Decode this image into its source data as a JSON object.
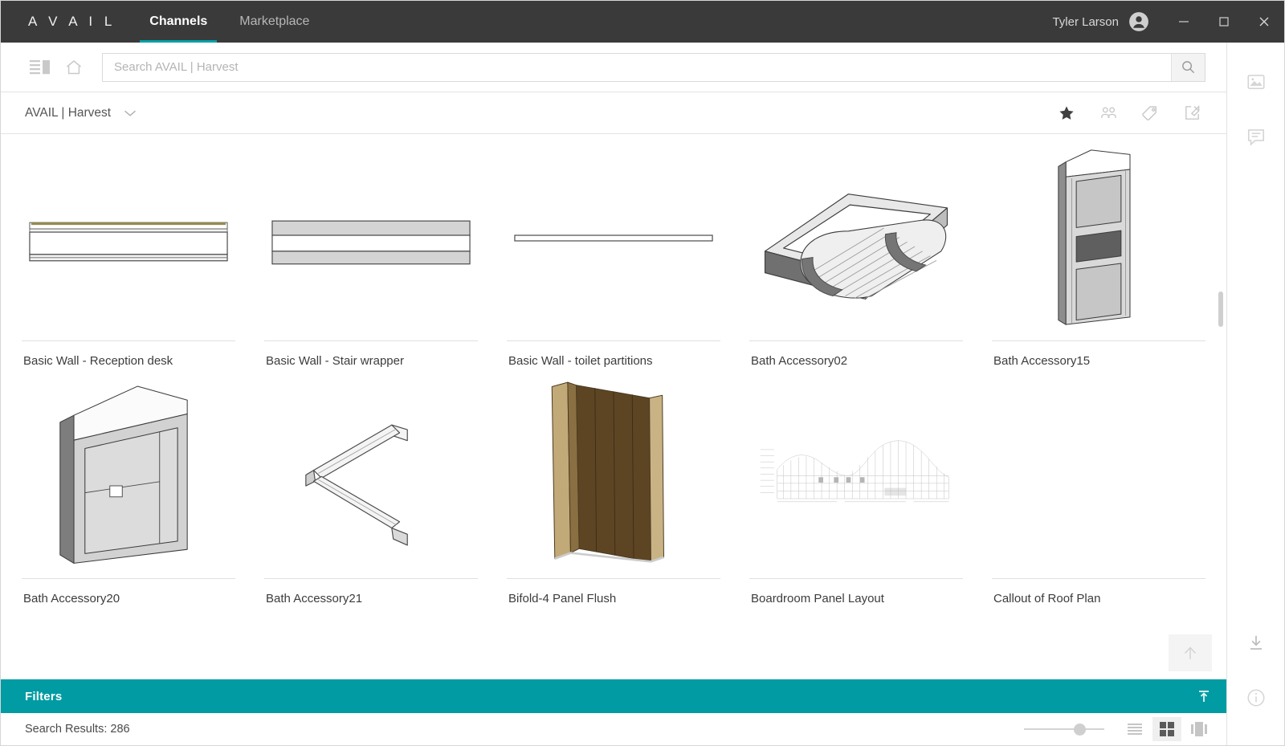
{
  "titlebar": {
    "brand": "A V A I L",
    "tabs": [
      {
        "label": "Channels",
        "active": true
      },
      {
        "label": "Marketplace",
        "active": false
      }
    ],
    "user": "Tyler Larson",
    "window_controls": [
      "minimize",
      "maximize",
      "close"
    ],
    "bg_color": "#3a3a3a",
    "accent_color": "#00a0a8"
  },
  "toolbar": {
    "panel_toggle": "panel-toggle-icon",
    "home": "home-icon",
    "search_placeholder": "Search AVAIL | Harvest",
    "search_value": "",
    "search_button": "search-icon"
  },
  "channel": {
    "name": "AVAIL | Harvest",
    "dropdown": "chevron-down-icon",
    "actions": [
      {
        "name": "favorite-star-icon",
        "active": true
      },
      {
        "name": "users-icon",
        "active": false
      },
      {
        "name": "tag-icon",
        "active": false
      },
      {
        "name": "edit-icon",
        "active": false
      }
    ]
  },
  "grid": {
    "rows": [
      {
        "items": [
          {
            "label": "Basic Wall - Reception desk",
            "thumb": "wall-section-reception"
          },
          {
            "label": "Basic Wall - Stair wrapper",
            "thumb": "wall-section-stair"
          },
          {
            "label": "Basic Wall - toilet partitions",
            "thumb": "wall-section-thin"
          },
          {
            "label": "Bath Accessory02",
            "thumb": "bath-accessory-tray-3d"
          },
          {
            "label": "Bath Accessory15",
            "thumb": "bath-accessory-panel-3d"
          }
        ]
      },
      {
        "items": [
          {
            "label": "Bath Accessory20",
            "thumb": "bath-cabinet-3d"
          },
          {
            "label": "Bath Accessory21",
            "thumb": "grab-bar-3d"
          },
          {
            "label": "Bifold-4 Panel Flush",
            "thumb": "bifold-door-3d"
          },
          {
            "label": "Boardroom Panel Layout",
            "thumb": "elevation-drawing"
          },
          {
            "label": "Callout of Roof Plan",
            "thumb": "empty"
          }
        ]
      }
    ],
    "scroll_to_top": "arrow-up-icon"
  },
  "filters": {
    "label": "Filters",
    "toggle_icon": "collapse-up-icon",
    "bar_color": "#009ba3"
  },
  "statusbar": {
    "results": "Search Results: 286",
    "zoom_slider": {
      "value": 62,
      "min": 0,
      "max": 100
    },
    "views": [
      {
        "name": "list-view-icon",
        "selected": false
      },
      {
        "name": "grid-view-icon",
        "selected": true
      },
      {
        "name": "carousel-view-icon",
        "selected": false
      }
    ]
  },
  "rail": {
    "top_icons": [
      {
        "name": "image-icon"
      },
      {
        "name": "comment-icon"
      }
    ],
    "bottom_icons": [
      {
        "name": "download-icon"
      },
      {
        "name": "info-icon"
      }
    ]
  }
}
